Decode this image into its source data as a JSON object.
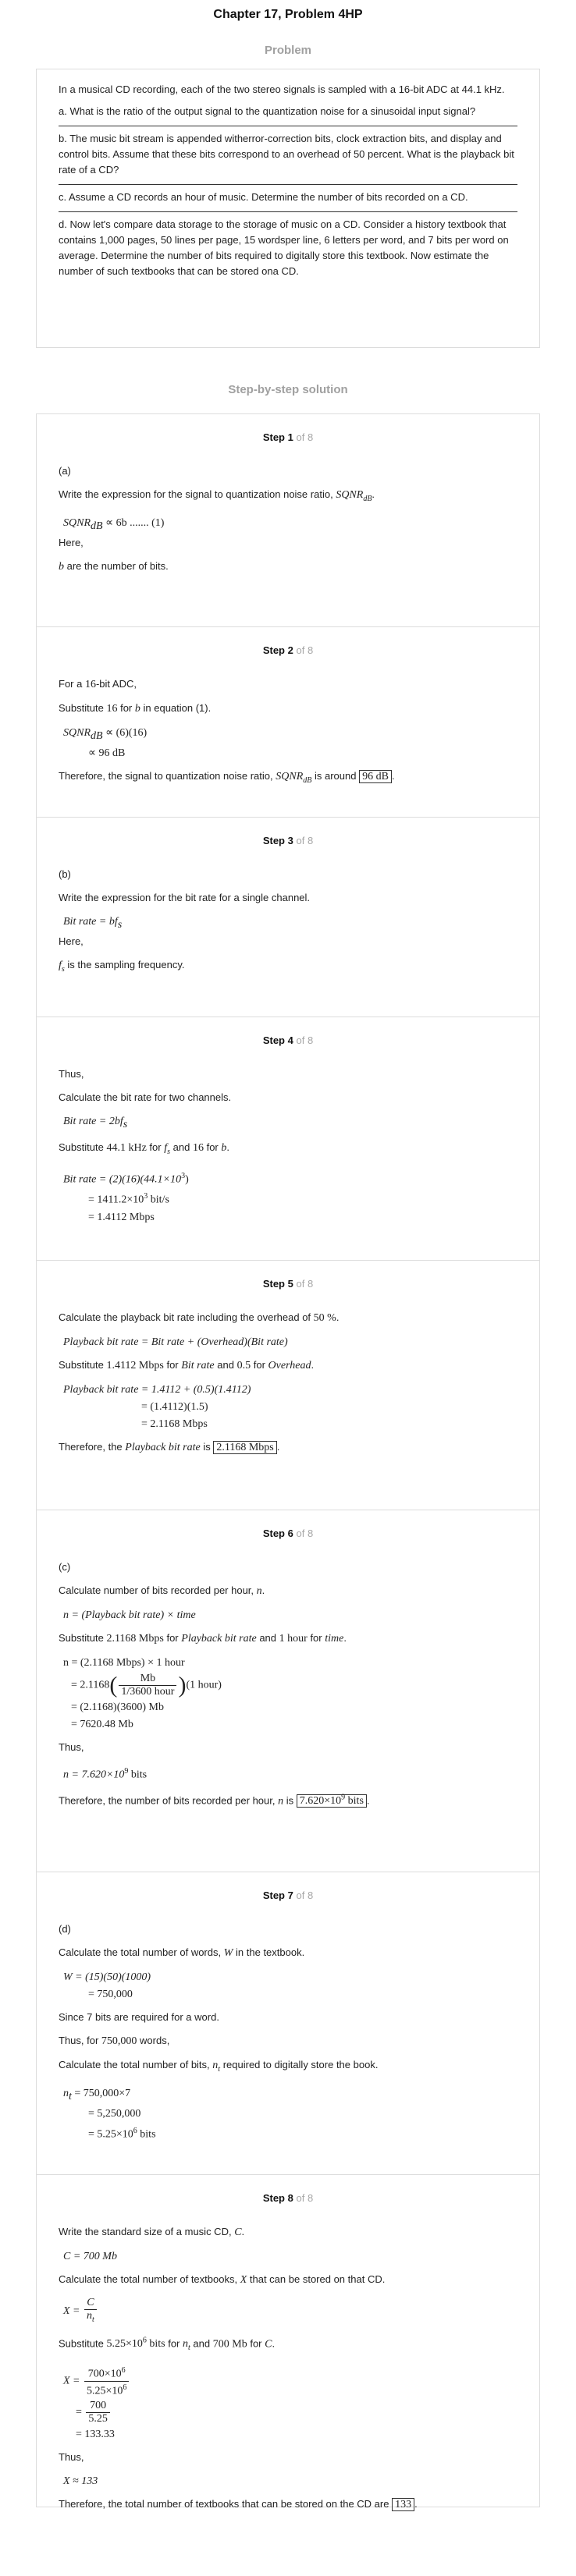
{
  "title": "Chapter 17, Problem 4HP",
  "problem_heading": "Problem",
  "problem": {
    "intro": "In a musical CD recording, each of the two stereo signals is sampled with a 16-bit ADC at 44.1 kHz.",
    "a": "a. What is the ratio of the output signal to the quantization noise for a sinusoidal input signal?",
    "b": "b. The music bit stream is appended witherror-correction bits, clock extraction bits, and display and control bits. Assume that these bits correspond to an overhead of 50 percent. What is the playback bit rate of a CD?",
    "c": "c. Assume a CD records an hour of music. Determine the number of bits recorded on a CD.",
    "d": "d. Now let's compare data storage to the storage of music on a CD. Consider a history textbook that contains 1,000 pages, 50 lines per page, 15 wordsper line, 6 letters per word, and 7 bits per word on average. Determine the number of bits required to digitally store this textbook. Now estimate the number of such textbooks that can be stored ona CD."
  },
  "solution_heading": "Step-by-step solution",
  "step_word": "Step",
  "step_total": "of 8",
  "steps": {
    "s1": {
      "num": "1",
      "part": "(a)",
      "l1": "Write the expression for the signal to quantization noise ratio,",
      "sym": "SQNR",
      "sym_sub": "dB",
      "eq1": "SQNR",
      "eq1_sub": "dB",
      "eq1_rhs": "∝ 6b ....... (1)",
      "here": "Here,",
      "b_sym": "b",
      "b_text": "are the number of bits."
    },
    "s2": {
      "num": "2",
      "l1a": "For a",
      "l1b": "16",
      "l1c": "-bit ADC,",
      "l2a": "Substitute",
      "l2b": "16",
      "l2c": "for",
      "l2d": "b",
      "l2e": "in equation (1).",
      "eq1": "SQNR",
      "eq1_sub": "dB",
      "eq1_rhs": "∝ (6)(16)",
      "eq2": "∝ 96 dB",
      "concl_a": "Therefore, the signal to quantization noise ratio,",
      "concl_sym": "SQNR",
      "concl_sub": "dB",
      "concl_b": "is around",
      "ans": "96 dB"
    },
    "s3": {
      "num": "3",
      "part": "(b)",
      "l1": "Write the expression for the bit rate for a single channel.",
      "eq1": "Bit rate = bf",
      "eq1_sub": "s",
      "here": "Here,",
      "fs_sym": "f",
      "fs_sub": "s",
      "fs_text": "is the sampling frequency."
    },
    "s4": {
      "num": "4",
      "l1": "Thus,",
      "l2": "Calculate the bit rate for two channels.",
      "eq1": "Bit rate = 2bf",
      "eq1_sub": "s",
      "l3a": "Substitute",
      "l3b": "44.1 kHz",
      "l3c": "for",
      "l3d": "f",
      "l3d_sub": "s",
      "l3e": "and",
      "l3f": "16",
      "l3g": "for",
      "l3h": "b",
      "eq2": "Bit rate = (2)(16)(44.1×10",
      "eq2_sup": "3",
      "eq2_end": ")",
      "eq3": "= 1411.2×10",
      "eq3_sup": "3",
      "eq3_end": " bit/s",
      "eq4": "= 1.4112 Mbps"
    },
    "s5": {
      "num": "5",
      "l1a": "Calculate the playback bit rate including the overhead of",
      "l1b": "50 %",
      "l1c": ".",
      "eq1": "Playback bit rate = Bit rate + (Overhead)(Bit rate)",
      "l2a": "Substitute",
      "l2b": "1.4112 Mbps",
      "l2c": "for",
      "l2d": "Bit rate",
      "l2e": "and",
      "l2f": "0.5",
      "l2g": "for",
      "l2h": "Overhead",
      "l2i": ".",
      "eq2": "Playback bit rate = 1.4112 + (0.5)(1.4112)",
      "eq3": "= (1.4112)(1.5)",
      "eq4": "= 2.1168 Mbps",
      "concl_a": "Therefore, the",
      "concl_sym": "Playback bit rate",
      "concl_b": "is",
      "ans": "2.1168 Mbps"
    },
    "s6": {
      "num": "6",
      "part": "(c)",
      "l1a": "Calculate number of bits recorded per hour,",
      "l1b": "n",
      "l1c": ".",
      "eq1": "n = (Playback bit rate) × time",
      "l2a": "Substitute",
      "l2b": "2.1168 Mbps",
      "l2c": "for",
      "l2d": "Playback bit rate",
      "l2e": "and",
      "l2f": "1 hour",
      "l2g": "for",
      "l2h": "time",
      "l2i": ".",
      "eq2": "n = (2.1168 Mbps) × 1 hour",
      "eq3a": "= 2.1168",
      "eq3_num": "Mb",
      "eq3_den": "1/3600 hour",
      "eq3b": "(1 hour)",
      "eq4": "= (2.1168)(3600) Mb",
      "eq5": "= 7620.48 Mb",
      "thus": "Thus,",
      "eq6": "n = 7.620×10",
      "eq6_sup": "9",
      "eq6_end": " bits",
      "concl_a": "Therefore, the number of bits recorded per hour,",
      "concl_sym": "n",
      "concl_b": "is",
      "ans": "7.620×10",
      "ans_sup": "9",
      "ans_end": " bits"
    },
    "s7": {
      "num": "7",
      "part": "(d)",
      "l1a": "Calculate the total number of words,",
      "l1b": "W",
      "l1c": "in the textbook.",
      "eq1": "W = (15)(50)(1000)",
      "eq2": "= 750,000",
      "l2": "Since 7 bits are required for a word.",
      "l3a": "Thus, for",
      "l3b": "750,000",
      "l3c": "words,",
      "l4a": "Calculate the total number of bits,",
      "l4b": "n",
      "l4b_sub": "t",
      "l4c": "required to digitally store the book.",
      "eq3": "n",
      "eq3_sub": "t",
      "eq3_rhs": "= 750,000×7",
      "eq4": "= 5,250,000",
      "eq5": "= 5.25×10",
      "eq5_sup": "6",
      "eq5_end": " bits"
    },
    "s8": {
      "num": "8",
      "l1a": "Write the standard size of a music CD,",
      "l1b": "C",
      "l1c": ".",
      "eq1": "C = 700 Mb",
      "l2a": "Calculate the total number of textbooks,",
      "l2b": "X",
      "l2c": "that can be stored on that CD.",
      "eq2a": "X =",
      "eq2_num": "C",
      "eq2_den": "n",
      "eq2_den_sub": "t",
      "l3a": "Substitute",
      "l3b": "5.25×10",
      "l3b_sup": "6",
      "l3b_end": " bits",
      "l3c": "for",
      "l3d": "n",
      "l3d_sub": "t",
      "l3e": "and",
      "l3f": "700 Mb",
      "l3g": "for",
      "l3h": "C",
      "l3i": ".",
      "eq3a": "X =",
      "eq3_num": "700×10",
      "eq3_num_sup": "6",
      "eq3_den": "5.25×10",
      "eq3_den_sup": "6",
      "eq4_num": "700",
      "eq4_den": "5.25",
      "eq5": "= 133.33",
      "thus": "Thus,",
      "eq6": "X ≈ 133",
      "concl_a": "Therefore, the total number of textbooks that can be stored on the CD are",
      "ans": "133",
      "concl_b": "."
    }
  }
}
